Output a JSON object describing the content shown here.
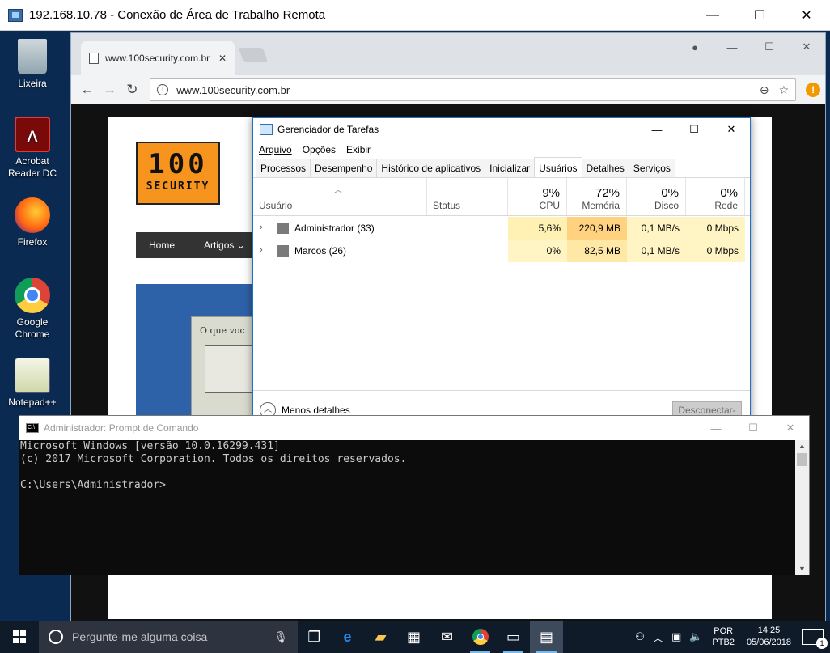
{
  "rdp": {
    "title": "192.168.10.78 - Conexão de Área de Trabalho Remota"
  },
  "desktop_icons": [
    {
      "label": "Lixeira",
      "icon": "recycle-bin-icon"
    },
    {
      "label": "Acrobat Reader DC",
      "icon": "acrobat-icon"
    },
    {
      "label": "Firefox",
      "icon": "firefox-icon"
    },
    {
      "label": "Google Chrome",
      "icon": "chrome-icon"
    },
    {
      "label": "Notepad++",
      "icon": "notepadpp-icon"
    }
  ],
  "chrome": {
    "tab_title": "www.100security.com.br",
    "url": "www.100security.com.br",
    "alert_badge": "!"
  },
  "site": {
    "logo_big": "100",
    "logo_small": "SECURITY",
    "nav": [
      "Home",
      "Artigos ⌄"
    ],
    "banner_text": "O que voc"
  },
  "taskmgr": {
    "title": "Gerenciador de Tarefas",
    "menu": [
      "Arquivo",
      "Opções",
      "Exibir"
    ],
    "tabs": [
      "Processos",
      "Desempenho",
      "Histórico de aplicativos",
      "Inicializar",
      "Usuários",
      "Detalhes",
      "Serviços"
    ],
    "active_tab": "Usuários",
    "columns": {
      "user": "Usuário",
      "status": "Status",
      "cpu": {
        "pct": "9%",
        "label": "CPU"
      },
      "mem": {
        "pct": "72%",
        "label": "Memória"
      },
      "disk": {
        "pct": "0%",
        "label": "Disco"
      },
      "net": {
        "pct": "0%",
        "label": "Rede"
      }
    },
    "rows": [
      {
        "name": "Administrador (33)",
        "status": "",
        "cpu": "5,6%",
        "mem": "220,9 MB",
        "disk": "0,1 MB/s",
        "net": "0 Mbps"
      },
      {
        "name": "Marcos (26)",
        "status": "",
        "cpu": "0%",
        "mem": "82,5 MB",
        "disk": "0,1 MB/s",
        "net": "0 Mbps"
      }
    ],
    "fewer_details": "Menos detalhes",
    "disconnect": "Desconectar-se"
  },
  "cmd": {
    "title": "Administrador: Prompt de Comando",
    "line1": "Microsoft Windows [versão 10.0.16299.431]",
    "line2": "(c) 2017 Microsoft Corporation. Todos os direitos reservados.",
    "line3": "",
    "line4": "C:\\Users\\Administrador>"
  },
  "taskbar": {
    "search_placeholder": "Pergunte-me alguma coisa",
    "lang_top": "POR",
    "lang_bottom": "PTB2",
    "time": "14:25",
    "date": "05/06/2018",
    "notif_count": "1"
  },
  "colors": {
    "desktop_bg": "#0b2a52",
    "taskbar_bg": "#101b2a",
    "heat_strong": "#ffd280",
    "heat_light": "#fff4c4",
    "tab_active_border": "#1a73c8"
  }
}
